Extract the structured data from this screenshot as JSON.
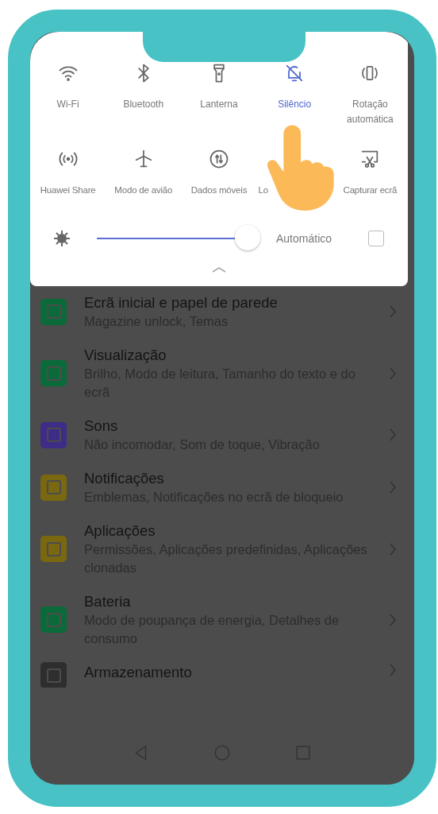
{
  "quick_tiles": [
    {
      "label": "Wi-Fi",
      "active": false
    },
    {
      "label": "Bluetooth",
      "active": false
    },
    {
      "label": "Lanterna",
      "active": false
    },
    {
      "label": "Silêncio",
      "active": true
    },
    {
      "label": "Rotação automática",
      "active": false
    },
    {
      "label": "Huawei Share",
      "active": false
    },
    {
      "label": "Modo de avião",
      "active": false
    },
    {
      "label": "Dados móveis",
      "active": false
    },
    {
      "label": "Lo",
      "active": false,
      "kind": "covered"
    },
    {
      "label": "Capturar ecrã",
      "active": false
    }
  ],
  "brightness": {
    "level": 0.95,
    "auto_label": "Automático",
    "auto_checked": false
  },
  "settings": [
    {
      "title": "Ecrã inicial e papel de parede",
      "subtitle": "Magazine unlock, Temas",
      "color": "#0b6a3a"
    },
    {
      "title": "Visualização",
      "subtitle": "Brilho, Modo de leitura, Tamanho do texto e do ecrã",
      "color": "#0b6a3a"
    },
    {
      "title": "Sons",
      "subtitle": "Não incomodar, Som de toque, Vibração",
      "color": "#3e2c86"
    },
    {
      "title": "Notificações",
      "subtitle": "Emblemas, Notificações no ecrã de bloqueio",
      "color": "#7a6810"
    },
    {
      "title": "Aplicações",
      "subtitle": "Permissões, Aplicações predefinidas, Aplicações clonadas",
      "color": "#7a6810"
    },
    {
      "title": "Bateria",
      "subtitle": "Modo de poupança de energia, Detalhes de consumo",
      "color": "#0b6a3a"
    },
    {
      "title": "Armazenamento",
      "color": "#2e2e2e"
    }
  ]
}
